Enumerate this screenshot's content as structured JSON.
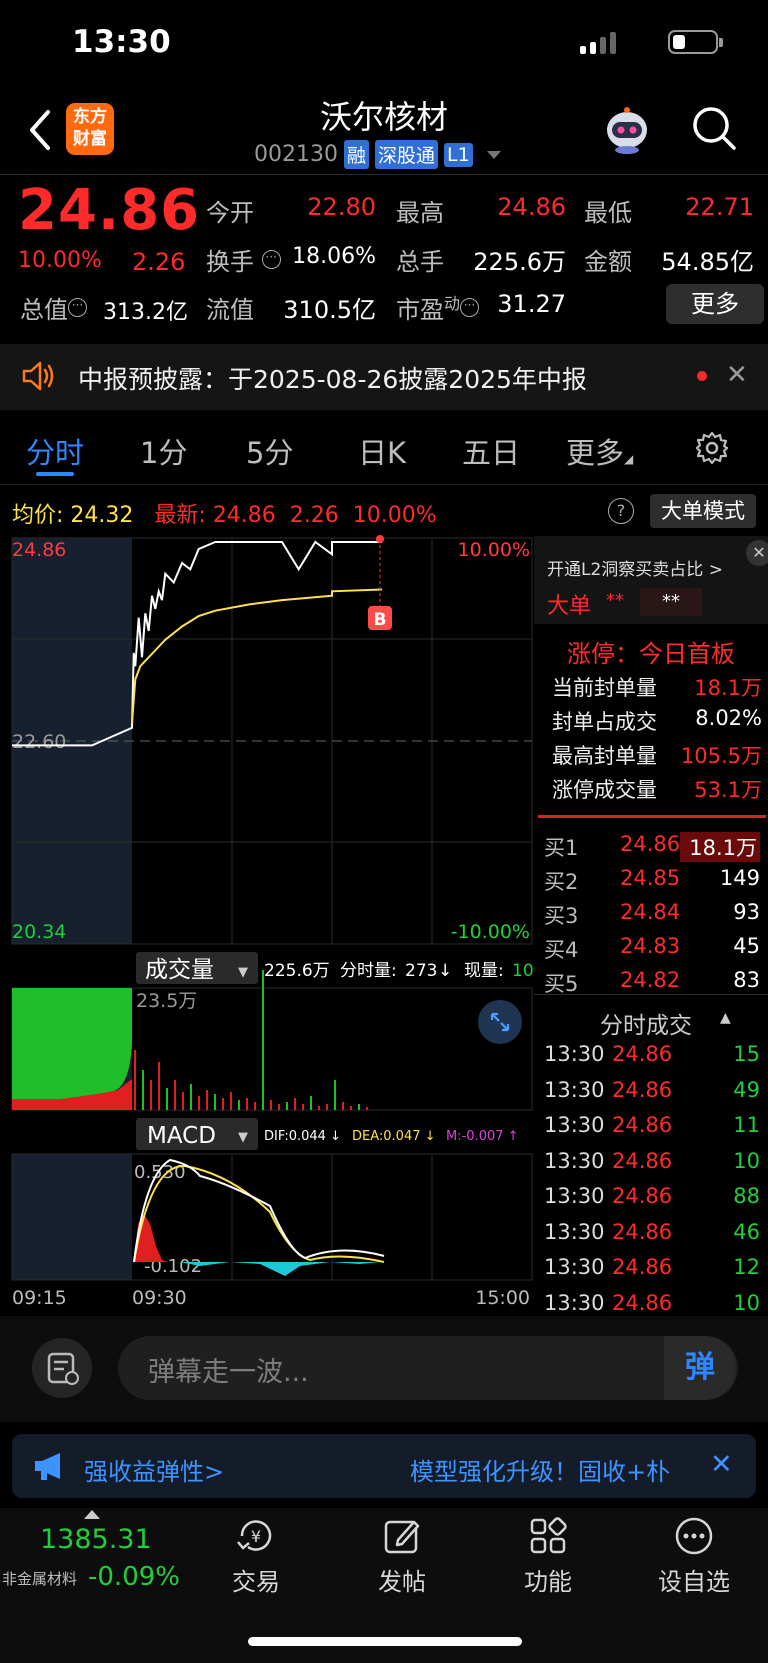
{
  "status": {
    "time": "13:30"
  },
  "header": {
    "logo_text": "东方财富",
    "stock_name": "沃尔核材",
    "code": "002130",
    "tags": [
      "融",
      "深股通",
      "L1"
    ]
  },
  "quote": {
    "price": "24.86",
    "pct": "10.00%",
    "change": "2.26",
    "fields": {
      "open_label": "今开",
      "open": "22.80",
      "high_label": "最高",
      "high": "24.86",
      "low_label": "最低",
      "low": "22.71",
      "turnover_label": "换手",
      "turnover": "18.06%",
      "volume_label": "总手",
      "volume": "225.6万",
      "amount_label": "金额",
      "amount": "54.85亿",
      "mktcap_label": "总值",
      "mktcap": "313.2亿",
      "float_label": "流值",
      "float": "310.5亿",
      "pe_label": "市盈",
      "pe_sup": "动",
      "pe": "31.27"
    },
    "more_label": "更多"
  },
  "notice": {
    "text": "中报预披露：于2025-08-26披露2025年中报"
  },
  "tabs": [
    "分时",
    "1分",
    "5分",
    "日K",
    "五日",
    "更多"
  ],
  "chart_header": {
    "avg_label": "均价:",
    "avg": "24.32",
    "latest_label": "最新:",
    "latest": "24.86",
    "latest_change": "2.26",
    "latest_pct": "10.00%",
    "help": "?",
    "big_order_mode": "大单模式"
  },
  "chart_data": {
    "type": "line",
    "title": "",
    "price_axis": {
      "max": "24.86",
      "mid": "22.60",
      "min": "20.34",
      "pct_max": "10.00%",
      "pct_min": "-10.00%"
    },
    "x_ticks": [
      "09:15",
      "09:30",
      "15:00"
    ],
    "ylim": [
      20.34,
      24.86
    ],
    "series": [
      {
        "name": "price",
        "color": "#ffffff",
        "x": [
          "09:15",
          "09:25",
          "09:30",
          "09:31",
          "09:32",
          "09:34",
          "09:36",
          "09:38",
          "09:40",
          "09:42",
          "09:44",
          "09:46",
          "09:48",
          "09:50",
          "09:55",
          "10:00",
          "10:05",
          "10:10",
          "10:20",
          "10:30",
          "10:40",
          "10:50",
          "11:00",
          "11:10",
          "11:20",
          "11:30",
          "13:00",
          "13:15",
          "13:30"
        ],
        "values": [
          22.55,
          22.55,
          22.75,
          23.6,
          23.45,
          24.0,
          23.55,
          24.05,
          23.85,
          24.25,
          24.1,
          24.3,
          24.2,
          24.5,
          24.4,
          24.62,
          24.55,
          24.78,
          24.86,
          24.86,
          24.86,
          24.86,
          24.86,
          24.55,
          24.86,
          24.72,
          24.86,
          24.86,
          24.86
        ]
      },
      {
        "name": "avg",
        "color": "#ffe14d",
        "x": [
          "09:30",
          "09:32",
          "09:35",
          "09:40",
          "09:45",
          "09:50",
          "10:00",
          "10:10",
          "10:20",
          "10:40",
          "11:00",
          "11:30",
          "13:00",
          "13:30"
        ],
        "values": [
          22.8,
          23.3,
          23.45,
          23.55,
          23.65,
          23.75,
          23.9,
          24.02,
          24.08,
          24.15,
          24.2,
          24.25,
          24.3,
          24.32
        ]
      }
    ],
    "marker": "B",
    "volume": {
      "label": "成交量",
      "total": "225.6万",
      "minute_label": "分时量:",
      "minute": "273",
      "current_label": "现量:",
      "current": "10",
      "max_label": "23.5万"
    },
    "macd": {
      "label": "MACD",
      "dif_label": "DIF:0.044 ↓",
      "dea_label": "DEA:0.047 ↓",
      "m_label": "M:-0.007 ↑",
      "top": "0.530",
      "bottom": "-0.102"
    }
  },
  "right_panel": {
    "promo": "开通L2洞察买卖占比 >",
    "big_order_label": "大单",
    "big_order_val": "**",
    "big_order_val2": "**",
    "limit_title": "涨停：今日首板",
    "limit_rows": [
      {
        "label": "当前封单量",
        "value": "18.1万"
      },
      {
        "label": "封单占成交",
        "value": "8.02%"
      },
      {
        "label": "最高封单量",
        "value": "105.5万"
      },
      {
        "label": "涨停成交量",
        "value": "53.1万"
      }
    ],
    "bids": [
      {
        "label": "买1",
        "price": "24.86",
        "qty": "18.1万"
      },
      {
        "label": "买2",
        "price": "24.85",
        "qty": "149"
      },
      {
        "label": "买3",
        "price": "24.84",
        "qty": "93"
      },
      {
        "label": "买4",
        "price": "24.83",
        "qty": "45"
      },
      {
        "label": "买5",
        "price": "24.82",
        "qty": "83"
      }
    ],
    "ticks_title": "分时成交",
    "ticks": [
      {
        "time": "13:30",
        "price": "24.86",
        "qty": "15"
      },
      {
        "time": "13:30",
        "price": "24.86",
        "qty": "49"
      },
      {
        "time": "13:30",
        "price": "24.86",
        "qty": "11"
      },
      {
        "time": "13:30",
        "price": "24.86",
        "qty": "10"
      },
      {
        "time": "13:30",
        "price": "24.86",
        "qty": "88"
      },
      {
        "time": "13:30",
        "price": "24.86",
        "qty": "46"
      },
      {
        "time": "13:30",
        "price": "24.86",
        "qty": "12"
      },
      {
        "time": "13:30",
        "price": "24.86",
        "qty": "10"
      }
    ]
  },
  "danmaku": {
    "placeholder": "弹幕走一波...",
    "send": "弹"
  },
  "ad": {
    "left": "强收益弹性>",
    "right": "模型强化升级！固收+朴"
  },
  "bottom": {
    "index_value": "1385.31",
    "index_name": "非金属材料",
    "index_change": "-0.09%",
    "nav": [
      "交易",
      "发帖",
      "功能",
      "设自选"
    ]
  }
}
